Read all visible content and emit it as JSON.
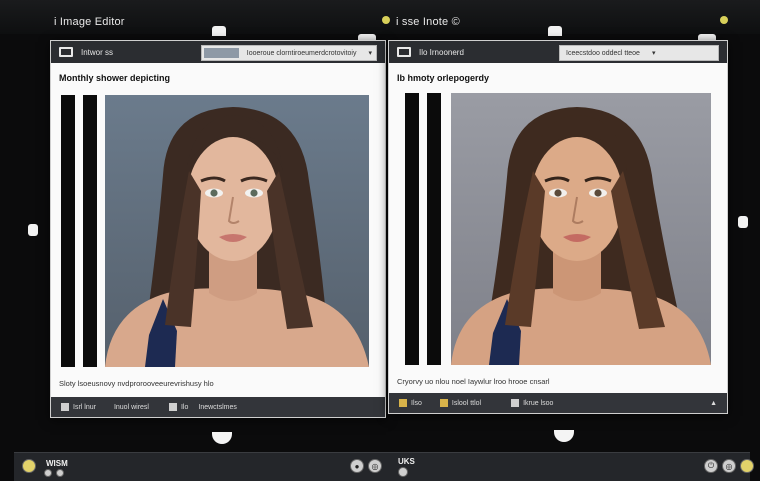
{
  "monitor": {
    "left_title": "i Image Editor",
    "right_title": "i sse Inote ©"
  },
  "windows": [
    {
      "doc_name": "Intwor ss",
      "address": "Iooeroue clorntiroeumerdcrotovitoiy",
      "heading": "Monthly shower depicting",
      "caption": "Sloty lsoeusnovy nvdprorooveeurevrishusy hlo",
      "footer": [
        "Isrl lnur",
        "Inuol wiresl",
        "Ilo",
        "Inewctslmes"
      ]
    },
    {
      "doc_name": "Ilo Irnoonerd",
      "address": "Iceecstdoo oddecl tteoe",
      "heading": "Ib hmoty orlepogerdy",
      "caption": "Cryorvy uo nlou noel Iaywlur lroo hrooe cnsarl",
      "footer": [
        "Ilso",
        "Islool ttlol",
        "Ikrue lsoo",
        ""
      ]
    }
  ],
  "taskbar": {
    "left_label": "WISM",
    "right_label": "UKS"
  },
  "colors": {
    "bezel": "#111214",
    "window_bar": "#2b2d31",
    "photo_bg_left": "#5f6e7f",
    "photo_bg_right": "#8a8c95"
  }
}
